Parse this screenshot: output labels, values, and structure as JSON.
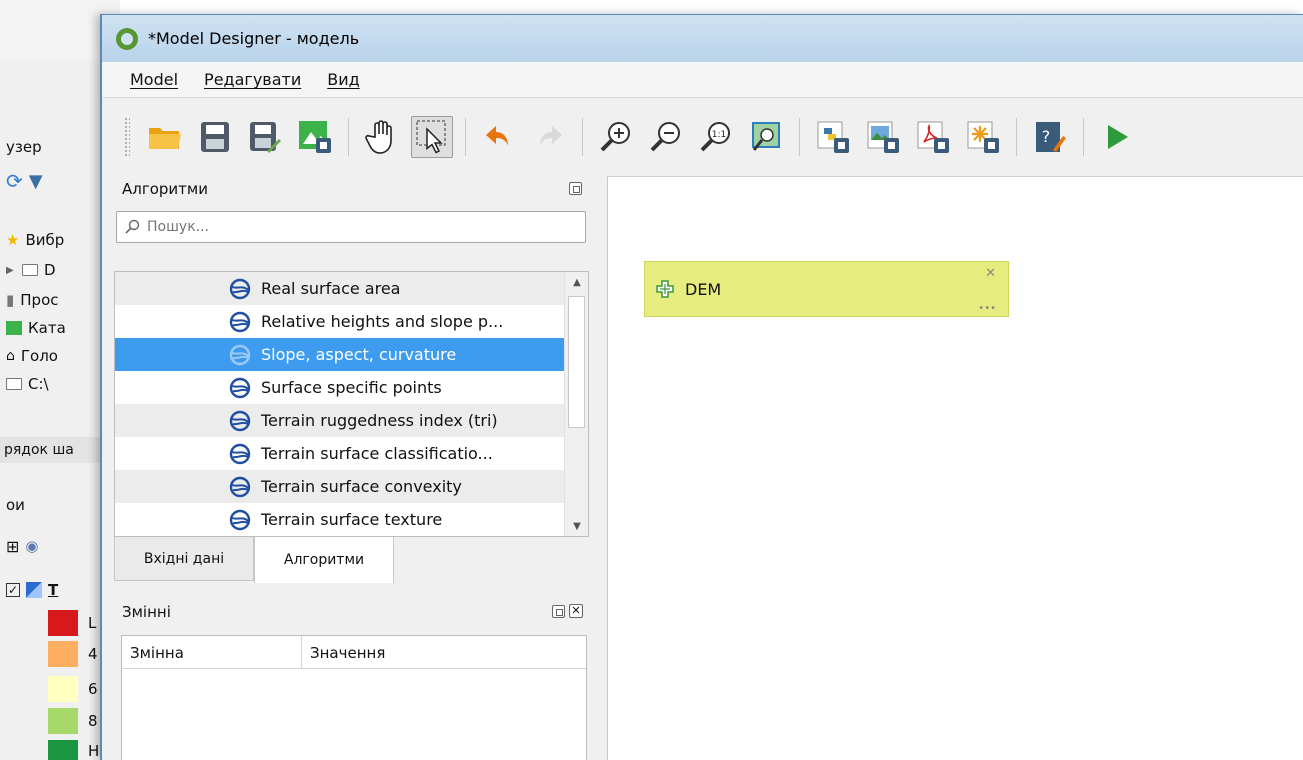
{
  "background_window": {
    "browser_label": "узер",
    "tree": [
      {
        "label": "Вибр",
        "icon": "star-icon"
      },
      {
        "label": "D",
        "icon": "folder-icon"
      },
      {
        "label": "Прос",
        "icon": "project-icon"
      },
      {
        "label": "Ката",
        "icon": "catalog-icon"
      },
      {
        "label": "Голо",
        "icon": "home-icon"
      },
      {
        "label": "C:\\",
        "icon": "folder-icon"
      }
    ],
    "order_label": "рядок ша",
    "layers_label": "ои",
    "layer_name": "Т",
    "legend_labels": [
      "L",
      "4",
      "6",
      "8",
      "H"
    ],
    "legend_colors": [
      "#d7191c",
      "#fdae61",
      "#ffffbf",
      "#a6d96a",
      "#1a9641"
    ]
  },
  "window": {
    "title": "*Model Designer - модель"
  },
  "menu": [
    "Model",
    "Редагувати",
    "Вид"
  ],
  "toolbar": [
    {
      "name": "open-model-button",
      "icon": "folder-open-icon"
    },
    {
      "name": "save-model-button",
      "icon": "save-icon"
    },
    {
      "name": "save-as-button",
      "icon": "save-as-icon"
    },
    {
      "name": "save-to-project-button",
      "icon": "save-to-project-icon"
    },
    {
      "name": "pan-button",
      "icon": "hand-icon"
    },
    {
      "name": "select-button",
      "icon": "select-arrow-icon",
      "active": true
    },
    {
      "name": "undo-button",
      "icon": "undo-icon"
    },
    {
      "name": "redo-button",
      "icon": "redo-icon"
    },
    {
      "name": "zoom-in-button",
      "icon": "zoom-in-icon"
    },
    {
      "name": "zoom-out-button",
      "icon": "zoom-out-icon"
    },
    {
      "name": "zoom-actual-button",
      "icon": "zoom-1-1-icon"
    },
    {
      "name": "zoom-full-button",
      "icon": "zoom-full-icon"
    },
    {
      "name": "export-python-button",
      "icon": "export-python-icon"
    },
    {
      "name": "export-image-button",
      "icon": "export-image-icon"
    },
    {
      "name": "export-pdf-button",
      "icon": "export-pdf-icon"
    },
    {
      "name": "export-svg-button",
      "icon": "export-svg-icon"
    },
    {
      "name": "edit-help-button",
      "icon": "help-edit-icon"
    },
    {
      "name": "run-model-button",
      "icon": "run-icon"
    }
  ],
  "algorithms_panel": {
    "title": "Алгоритми",
    "search_placeholder": "Пошук...",
    "items": [
      {
        "label": "Real surface area",
        "selected": false
      },
      {
        "label": "Relative heights and slope p...",
        "selected": false
      },
      {
        "label": "Slope, aspect, curvature",
        "selected": true
      },
      {
        "label": "Surface specific points",
        "selected": false
      },
      {
        "label": "Terrain ruggedness index (tri)",
        "selected": false
      },
      {
        "label": "Terrain surface classificatio...",
        "selected": false
      },
      {
        "label": "Terrain surface convexity",
        "selected": false
      },
      {
        "label": "Terrain surface texture",
        "selected": false
      }
    ]
  },
  "tabs": [
    "Вхідні дані",
    "Алгоритми"
  ],
  "variables_panel": {
    "title": "Змінні",
    "columns": [
      "Змінна",
      "Значення"
    ]
  },
  "canvas": {
    "input_node_label": "DEM"
  },
  "colors": {
    "selection": "#3d9cf0",
    "node_fill": "#e6ec7e",
    "run_green": "#2e9a3b"
  }
}
